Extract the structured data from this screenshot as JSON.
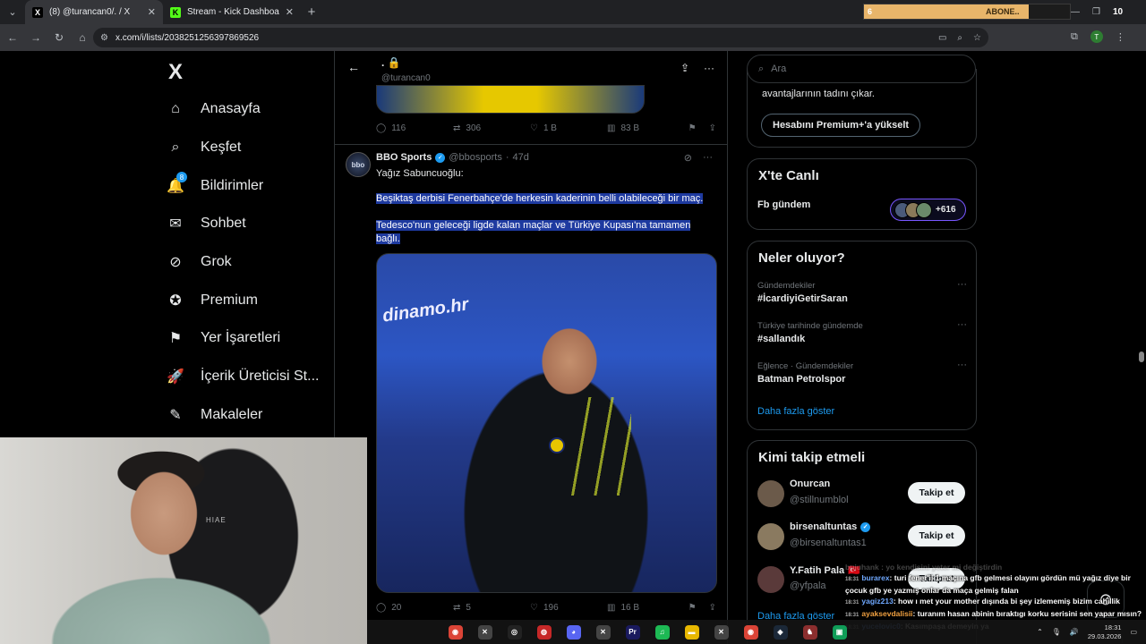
{
  "browser": {
    "tabs": [
      {
        "title": "(8) @turancan0/. / X",
        "favicon": "X",
        "active": true
      },
      {
        "title": "Stream - Kick Dashboard",
        "favicon": "K",
        "active": false
      }
    ],
    "url": "x.com/i/lists/2038251256397869526",
    "subscribe_widget": {
      "count": "6",
      "label": "ABONE..",
      "right_count": "10",
      "progress": 0.8
    }
  },
  "sidebar": {
    "logo": "X",
    "items": [
      {
        "label": "Anasayfa",
        "icon": "home-icon",
        "glyph": "⌂"
      },
      {
        "label": "Keşfet",
        "icon": "search-icon",
        "glyph": "⌕"
      },
      {
        "label": "Bildirimler",
        "icon": "bell-icon",
        "glyph": "🔔",
        "badge": "8"
      },
      {
        "label": "Sohbet",
        "icon": "mail-icon",
        "glyph": "✉"
      },
      {
        "label": "Grok",
        "icon": "grok-icon",
        "glyph": "⊘"
      },
      {
        "label": "Premium",
        "icon": "premium-icon",
        "glyph": "✪"
      },
      {
        "label": "Yer İşaretleri",
        "icon": "bookmark-icon",
        "glyph": "⚑"
      },
      {
        "label": "İçerik Üreticisi St...",
        "icon": "rocket-icon",
        "glyph": "🚀"
      },
      {
        "label": "Makaleler",
        "icon": "article-icon",
        "glyph": "✎"
      }
    ]
  },
  "list_header": {
    "title": ". 🔒",
    "subtitle": "@turancan0"
  },
  "prev_tweet": {
    "replies": "116",
    "reposts": "306",
    "likes": "1 B",
    "views": "83 B"
  },
  "tweet": {
    "name": "BBO Sports",
    "handle": "@bbosports",
    "time": "47d",
    "avatar_text": "bbo",
    "intro": "Yağız Sabuncuoğlu:",
    "line1": "Beşiktaş derbisi Fenerbahçe'de herkesin kaderinin belli olabileceği bir maç.",
    "line2": "Tedesco'nun geleceği ligde kalan maçlar ve Türkiye Kupası'na tamamen bağlı.",
    "image_text": "dinamo.hr",
    "replies": "20",
    "reposts": "5",
    "likes": "196",
    "views": "16 B"
  },
  "right": {
    "search_placeholder": "Ara",
    "premium_text": "avantajlarının tadını çıkar.",
    "premium_button": "Hesabını Premium+'a yükselt",
    "live_title": "X'te Canlı",
    "live_name": "Fb gündem",
    "live_count": "+616",
    "trends_title": "Neler oluyor?",
    "trends": [
      {
        "category": "Gündemdekiler",
        "name": "#İcardiyiGetirSaran"
      },
      {
        "category": "Türkiye tarihinde gündemde",
        "name": "#sallandık"
      },
      {
        "category": "Eğlence · Gündemdekiler",
        "name": "Batman Petrolspor"
      }
    ],
    "trends_more": "Daha fazla göster",
    "who_title": "Kimi takip etmeli",
    "who": [
      {
        "name": "Onurcan",
        "handle": "@stillnumblol",
        "verified": false,
        "flag": ""
      },
      {
        "name": "birsenaltuntas",
        "handle": "@birsenaltuntas1",
        "verified": true,
        "flag": ""
      },
      {
        "name": "Y.Fatih Pala",
        "handle": "@yfpala",
        "verified": false,
        "flag": "🇹🇷"
      }
    ],
    "follow_label": "Takip et",
    "who_more": "Daha fazla göster"
  },
  "chat": [
    {
      "time": "",
      "user": "",
      "text": "bujuhank : yo kendisini yeter mi değiştirdin",
      "color": "#bbbbbb",
      "faded": true
    },
    {
      "time": "18:31",
      "user": "burarex",
      "text": ": turi fener'ii 1 maçına gfb gelmesi olayını gördün mü yağız diye bir",
      "color": "#6fa8ff",
      "faded": false
    },
    {
      "time": "",
      "user": "",
      "text": "çocuk gfb ye yazmış onlar da maça gelmiş falan",
      "color": "#ffffff",
      "faded": false
    },
    {
      "time": "18:31",
      "user": "yagiz213",
      "text": ": how ı met your mother dışında bi şey izlememiş bizim cahillik",
      "color": "#6fa8ff",
      "faded": false
    },
    {
      "time": "18:31",
      "user": "ayaksevdalisii",
      "text": ": turanım hasan abinin bıraktıgı korku serisini sen yapar mısın?",
      "color": "#f0a040",
      "faded": false
    },
    {
      "time": "18:31",
      "user": "yucelovic0",
      "text": ": Kasımpaşa demeyin ya",
      "color": "#6fa8ff",
      "faded": false
    }
  ],
  "webcam": {
    "chair_brand": "HIAE"
  },
  "taskbar": {
    "apps": [
      {
        "name": "chrome-taskbar-icon",
        "color": "#db4437",
        "glyph": "◉"
      },
      {
        "name": "app-taskbar-icon-1",
        "color": "#444444",
        "glyph": "✕"
      },
      {
        "name": "obs-taskbar-icon",
        "color": "#222222",
        "glyph": "◎"
      },
      {
        "name": "app-taskbar-icon-2",
        "color": "#c62828",
        "glyph": "◍"
      },
      {
        "name": "discord-taskbar-icon",
        "color": "#5865f2",
        "glyph": "◕"
      },
      {
        "name": "app-taskbar-icon-3",
        "color": "#444444",
        "glyph": "✕"
      },
      {
        "name": "premiere-taskbar-icon",
        "color": "#1a1a5e",
        "glyph": "Pr"
      },
      {
        "name": "spotify-taskbar-icon",
        "color": "#1db954",
        "glyph": "♫"
      },
      {
        "name": "folder-taskbar-icon",
        "color": "#e8b800",
        "glyph": "▬"
      },
      {
        "name": "app-taskbar-icon-4",
        "color": "#444444",
        "glyph": "✕"
      },
      {
        "name": "chrome-taskbar-icon-2",
        "color": "#db4437",
        "glyph": "◉"
      },
      {
        "name": "steam-taskbar-icon",
        "color": "#1b2838",
        "glyph": "◈"
      },
      {
        "name": "game-taskbar-icon",
        "color": "#8b2e2e",
        "glyph": "♞"
      },
      {
        "name": "app-taskbar-icon-5",
        "color": "#0f9d58",
        "glyph": "▣"
      }
    ],
    "time": "18:31",
    "date": "29.03.2026"
  }
}
